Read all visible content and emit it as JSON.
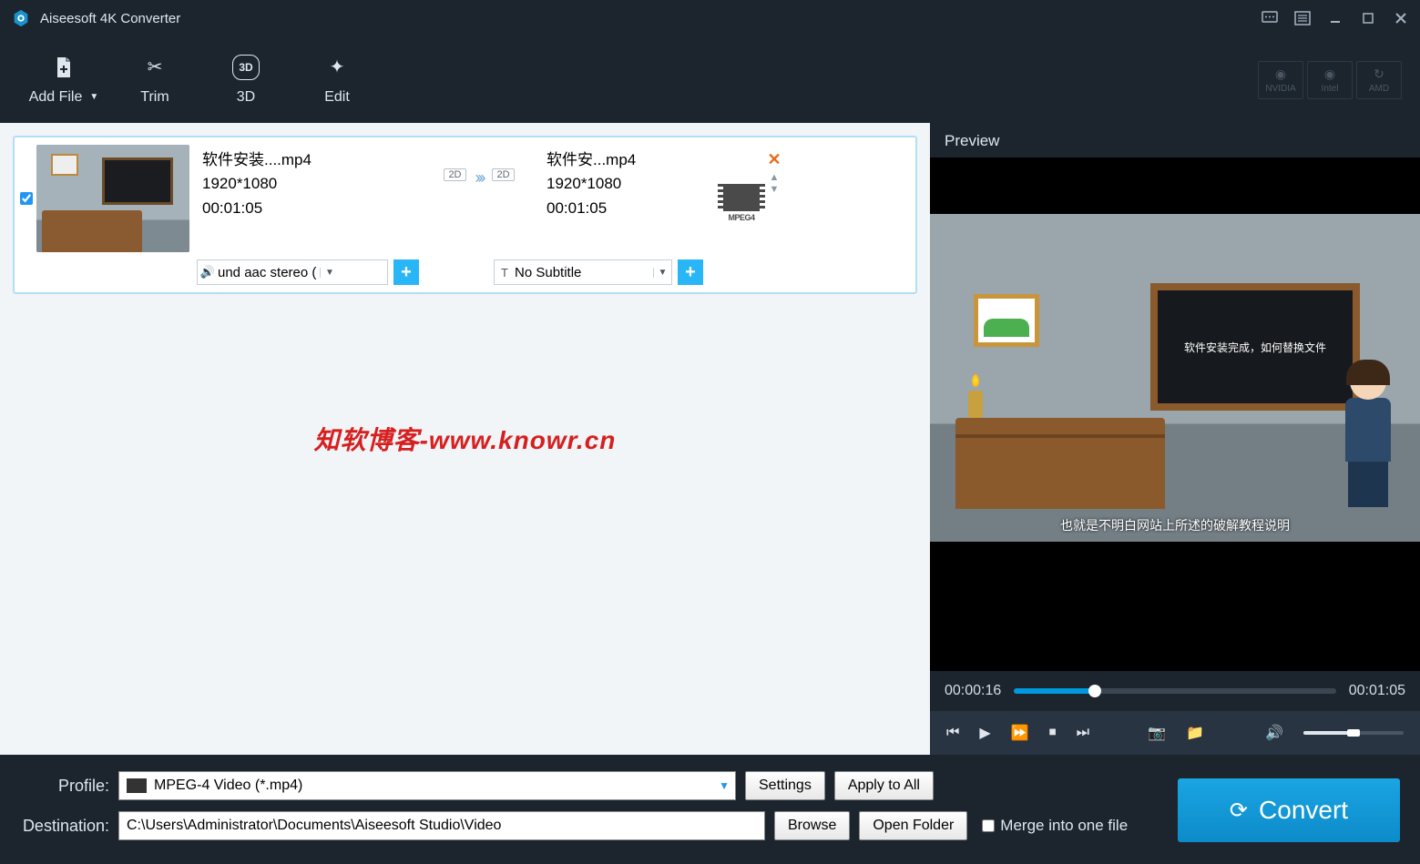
{
  "app": {
    "title": "Aiseesoft 4K Converter"
  },
  "toolbar": {
    "add_file": "Add File",
    "trim": "Trim",
    "three_d": "3D",
    "edit": "Edit",
    "gpu": {
      "nvidia": "NVIDIA",
      "intel": "Intel",
      "amd": "AMD"
    }
  },
  "file_item": {
    "source": {
      "name": "软件安装....mp4",
      "resolution": "1920*1080",
      "duration": "00:01:05"
    },
    "target": {
      "name": "软件安...mp4",
      "resolution": "1920*1080",
      "duration": "00:01:05"
    },
    "badge_2d": "2D",
    "format_label": "MPEG4",
    "audio_select": "und aac stereo (",
    "subtitle_select": "No Subtitle"
  },
  "watermark": "知软博客-www.knowr.cn",
  "preview": {
    "title": "Preview",
    "board_text": "软件安装完成，如何替换文件",
    "subtitle": "也就是不明白网站上所述的破解教程说明",
    "time_current": "00:00:16",
    "time_total": "00:01:05"
  },
  "bottom": {
    "profile_label": "Profile:",
    "profile_value": "MPEG-4 Video (*.mp4)",
    "settings": "Settings",
    "apply_all": "Apply to All",
    "destination_label": "Destination:",
    "destination_value": "C:\\Users\\Administrator\\Documents\\Aiseesoft Studio\\Video",
    "browse": "Browse",
    "open_folder": "Open Folder",
    "merge_label": "Merge into one file",
    "convert": "Convert"
  }
}
